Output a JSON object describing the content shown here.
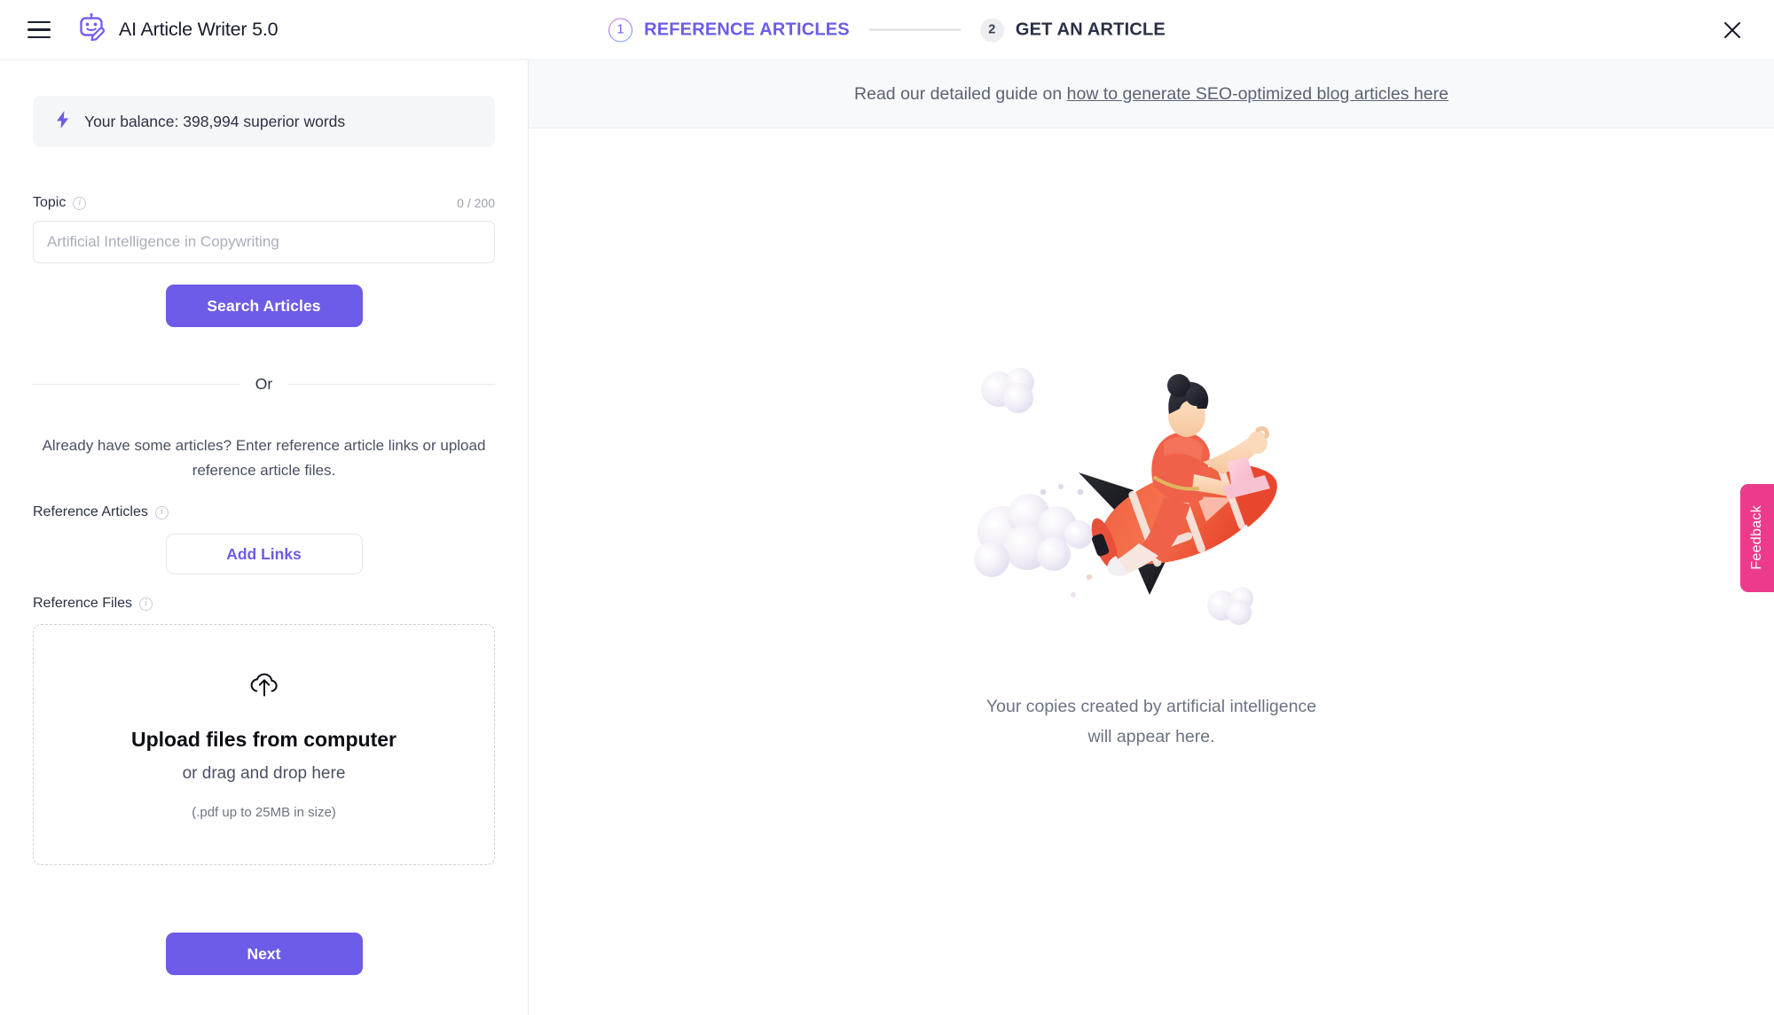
{
  "header": {
    "menu_icon": "hamburger-menu-icon",
    "logo_icon": "robot-pencil-logo-icon",
    "title": "AI Article Writer 5.0",
    "close_icon": "close-icon",
    "steps": [
      {
        "number": "1",
        "label": "REFERENCE ARTICLES",
        "state": "active"
      },
      {
        "number": "2",
        "label": "GET AN ARTICLE",
        "state": "inactive"
      }
    ]
  },
  "sidebar": {
    "balance": {
      "icon": "lightning-bolt-icon",
      "text": "Your balance: 398,994 superior words"
    },
    "topic": {
      "label": "Topic",
      "info_icon": "info-icon",
      "counter": "0 / 200",
      "value": "",
      "placeholder": "Artificial Intelligence in Copywriting"
    },
    "search_button": "Search Articles",
    "or_text": "Or",
    "reference_description": "Already have some articles? Enter reference article links or upload reference article files.",
    "reference_articles": {
      "label": "Reference Articles",
      "info_icon": "info-icon",
      "add_links_button": "Add Links"
    },
    "reference_files": {
      "label": "Reference Files",
      "info_icon": "info-icon",
      "upload_icon": "cloud-upload-icon",
      "title": "Upload files from computer",
      "subtitle": "or drag and drop here",
      "hint": "(.pdf up to 25MB in size)"
    },
    "next_button": "Next"
  },
  "main": {
    "guide_prefix": "Read our detailed guide on ",
    "guide_link": "how to generate SEO-optimized blog articles here",
    "illustration": "rocket-astronaut-illustration",
    "empty_line1": "Your copies created by artificial intelligence",
    "empty_line2": "will appear here."
  },
  "feedback": {
    "label": "Feedback"
  },
  "colors": {
    "accent_purple": "#6C5CE7",
    "feedback_pink": "#EC3B8C",
    "text_dark": "#2C3144",
    "text_muted": "#6B7283",
    "panel_bg": "#F8F9FB",
    "balance_bg": "#F5F6F8"
  }
}
